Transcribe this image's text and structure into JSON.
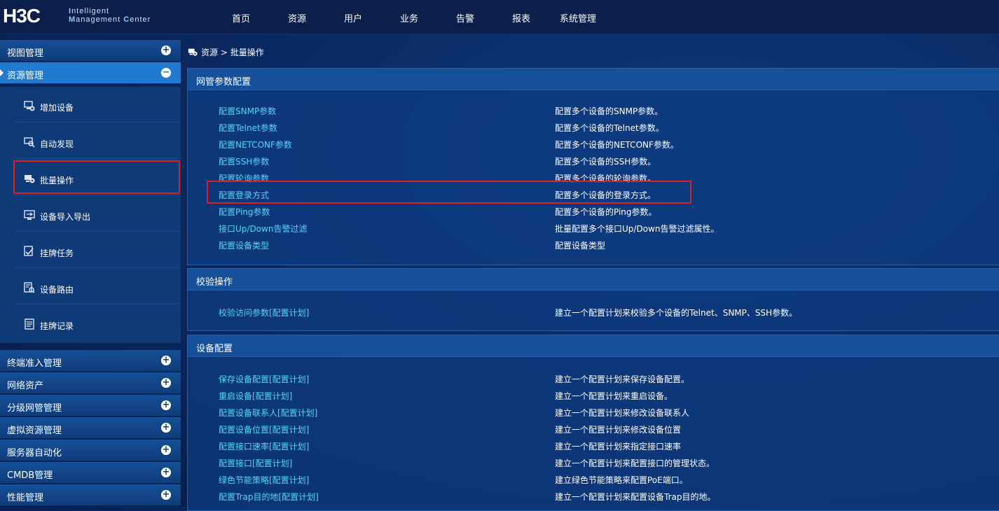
{
  "header": {
    "brand": "H3C",
    "tag_line1_initial": "I",
    "tag_line1_rest": "ntelligent",
    "tag_line2_initial1": "M",
    "tag_line2_rest1": "anagement",
    "tag_line2_initial2": "C",
    "tag_line2_rest2": "enter",
    "nav": [
      "首页",
      "资源",
      "用户",
      "业务",
      "告警",
      "报表",
      "系统管理"
    ]
  },
  "sidebar": {
    "groups_top": [
      {
        "label": "视图管理",
        "toggle": "+"
      },
      {
        "label": "资源管理",
        "toggle": "−"
      }
    ],
    "sub_items": [
      {
        "label": "增加设备",
        "icon": "add-device-icon"
      },
      {
        "label": "自动发现",
        "icon": "auto-discover-icon"
      },
      {
        "label": "批量操作",
        "icon": "batch-operation-icon"
      },
      {
        "label": "设备导入导出",
        "icon": "import-export-icon"
      },
      {
        "label": "挂牌任务",
        "icon": "tag-task-icon"
      },
      {
        "label": "设备路由",
        "icon": "device-route-icon"
      },
      {
        "label": "挂牌记录",
        "icon": "tag-record-icon"
      }
    ],
    "groups_bottom": [
      {
        "label": "终端准入管理",
        "toggle": "+"
      },
      {
        "label": "网络资产",
        "toggle": "+"
      },
      {
        "label": "分级网管管理",
        "toggle": "+"
      },
      {
        "label": "虚拟资源管理",
        "toggle": "+"
      },
      {
        "label": "服务器自动化",
        "toggle": "+"
      },
      {
        "label": "CMDB管理",
        "toggle": "+"
      },
      {
        "label": "性能管理",
        "toggle": "+"
      }
    ]
  },
  "breadcrumb": {
    "root": "资源",
    "sep": ">",
    "current": "批量操作"
  },
  "panels": [
    {
      "title": "网管参数配置",
      "rows": [
        {
          "link": "配置SNMP参数",
          "desc": "配置多个设备的SNMP参数。"
        },
        {
          "link": "配置Telnet参数",
          "desc": "配置多个设备的Telnet参数。"
        },
        {
          "link": "配置NETCONF参数",
          "desc": "配置多个设备的NETCONF参数。"
        },
        {
          "link": "配置SSH参数",
          "desc": "配置多个设备的SSH参数。"
        },
        {
          "link": "配置轮询参数",
          "desc": "配置多个设备的轮询参数。"
        },
        {
          "link": "配置登录方式",
          "desc": "配置多个设备的登录方式。"
        },
        {
          "link": "配置Ping参数",
          "desc": "配置多个设备的Ping参数。"
        },
        {
          "link": "接口Up/Down告警过滤",
          "desc": "批量配置多个接口Up/Down告警过滤属性。"
        },
        {
          "link": "配置设备类型",
          "desc": "配置设备类型"
        }
      ]
    },
    {
      "title": "校验操作",
      "rows": [
        {
          "link": "校验访问参数[配置计划]",
          "desc": "建立一个配置计划来校验多个设备的Telnet、SNMP、SSH参数。"
        }
      ]
    },
    {
      "title": "设备配置",
      "rows": [
        {
          "link": "保存设备配置[配置计划]",
          "desc": "建立一个配置计划来保存设备配置。"
        },
        {
          "link": "重启设备[配置计划]",
          "desc": "建立一个配置计划来重启设备。"
        },
        {
          "link": "配置设备联系人[配置计划]",
          "desc": "建立一个配置计划来修改设备联系人"
        },
        {
          "link": "配置设备位置[配置计划]",
          "desc": "建立一个配置计划来修改设备位置"
        },
        {
          "link": "配置接口速率[配置计划]",
          "desc": "建立一个配置计划来指定接口速率"
        },
        {
          "link": "配置接口[配置计划]",
          "desc": "建立一个配置计划来配置接口的管理状态。"
        },
        {
          "link": "绿色节能策略[配置计划]",
          "desc": "建立绿色节能策略来配置PoE端口。"
        },
        {
          "link": "配置Trap目的地[配置计划]",
          "desc": "建立一个配置计划来配置设备Trap目的地。"
        }
      ]
    }
  ],
  "colors": {
    "link": "#52d7ff",
    "highlight": "#e02020",
    "active_group": "#1f7ad0"
  }
}
